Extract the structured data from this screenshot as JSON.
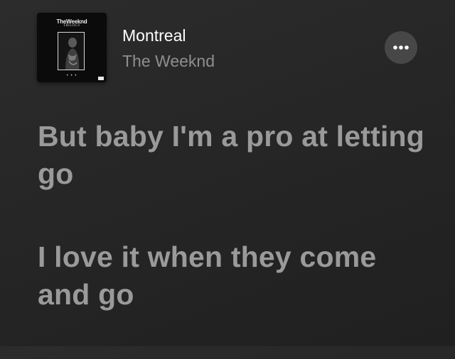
{
  "now_playing": {
    "artwork": {
      "artist_text": "TheWeeknd",
      "album_text": "TRILOGY",
      "dots": "• • •"
    },
    "title": "Montreal",
    "artist": "The Weeknd"
  },
  "more_button": {
    "icon": "ellipsis-icon"
  },
  "lyrics": {
    "lines": [
      "But baby I'm a pro at letting go",
      "I love it when they come and go"
    ]
  },
  "colors": {
    "background": "#262626",
    "title": "#ffffff",
    "artist": "#8f8f8f",
    "lyrics": "#9a9a9a",
    "more_button_bg": "#474747"
  }
}
